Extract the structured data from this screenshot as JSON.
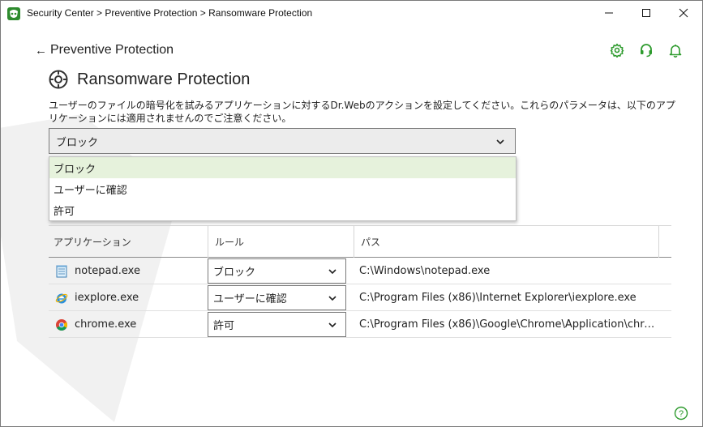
{
  "window": {
    "title": "Security Center > Preventive Protection > Ransomware Protection",
    "minimize_icon": "minimize-icon",
    "maximize_icon": "maximize-icon",
    "close_icon": "close-icon"
  },
  "header": {
    "back_label": "Preventive Protection",
    "back_icon": "arrow-left-icon",
    "icons": [
      "gear-icon",
      "headset-icon",
      "bell-icon"
    ],
    "accent_color": "#2e9b2e"
  },
  "page": {
    "title": "Ransomware Protection",
    "title_icon": "ransomware-shield-icon",
    "description": "ユーザーのファイルの暗号化を試みるアプリケーションに対するDr.Webのアクションを設定してください。これらのパラメータは、以下のアプリケーションには適用されませんのでご注意ください。"
  },
  "action_select": {
    "value": "ブロック",
    "options": [
      "ブロック",
      "ユーザーに確認",
      "許可"
    ],
    "highlighted_option": "ブロック",
    "highlight_color": "#e6f2dc"
  },
  "table": {
    "columns": [
      "アプリケーション",
      "ルール",
      "パス"
    ],
    "rows": [
      {
        "app": "notepad.exe",
        "icon": "notepad-icon",
        "rule": "ブロック",
        "path": "C:\\Windows\\notepad.exe"
      },
      {
        "app": "iexplore.exe",
        "icon": "internet-explorer-icon",
        "rule": "ユーザーに確認",
        "path": "C:\\Program Files (x86)\\Internet Explorer\\iexplore.exe"
      },
      {
        "app": "chrome.exe",
        "icon": "chrome-icon",
        "rule": "許可",
        "path": "C:\\Program Files (x86)\\Google\\Chrome\\Application\\chrom..."
      }
    ]
  },
  "footer": {
    "help_icon": "help-icon"
  }
}
